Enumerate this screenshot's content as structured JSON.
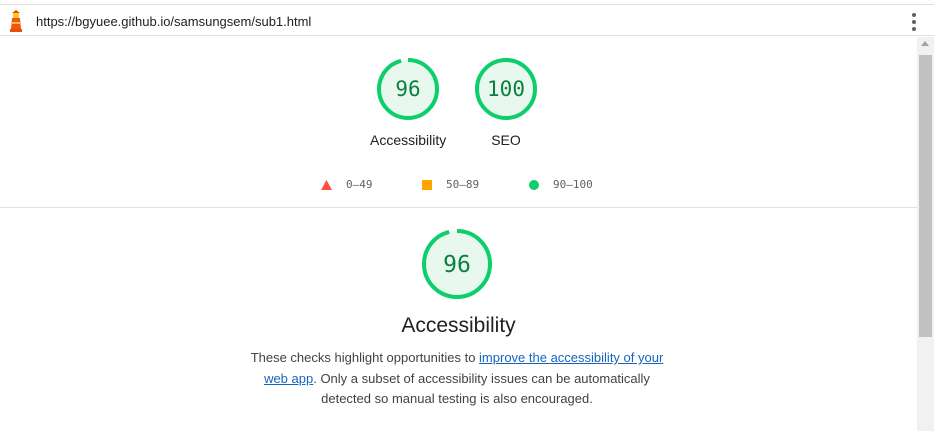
{
  "browser": {
    "url": "https://bgyuee.github.io/samsungsem/sub1.html",
    "logo_icon": "lighthouse-icon",
    "menu_icon": "kebab-menu-icon"
  },
  "colors": {
    "pass_green": "#0cce6b",
    "pass_text": "#0b8043",
    "pass_fill": "#e8f8ee",
    "average_orange": "#ffa400",
    "fail_red": "#ff4e42",
    "link_blue": "#1565c0"
  },
  "scores": [
    {
      "label": "Accessibility",
      "value": "96",
      "fraction": 0.96
    },
    {
      "label": "SEO",
      "value": "100",
      "fraction": 1.0
    }
  ],
  "legend": [
    {
      "shape": "triangle",
      "range": "0–49"
    },
    {
      "shape": "square",
      "range": "50–89"
    },
    {
      "shape": "circle",
      "range": "90–100"
    }
  ],
  "section": {
    "score": "96",
    "fraction": 0.96,
    "title": "Accessibility",
    "desc_before": "These checks highlight opportunities to ",
    "desc_link": "improve the accessibility of your web app",
    "desc_after": ". Only a subset of accessibility issues can be automatically detected so manual testing is also encouraged."
  }
}
